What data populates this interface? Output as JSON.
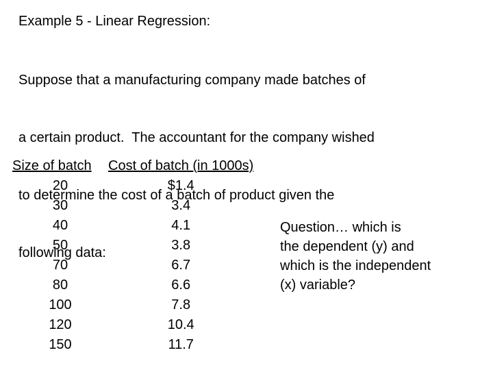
{
  "slide": {
    "title": "Example 5 - Linear Regression:",
    "intro_lines": [
      "Suppose that a manufacturing company made batches of",
      "a certain product.  The accountant for the company wished",
      "to determine the cost of a batch of product given the",
      "following data:"
    ],
    "question_lines": [
      "Question… which is",
      "the dependent (y) and",
      "which is the independent",
      "(x) variable?"
    ]
  },
  "chart_data": {
    "type": "table",
    "title": "Example 5 - Linear Regression:",
    "columns": [
      "Size of batch",
      "Cost of batch (in 1000s)"
    ],
    "xlabel": "Size of batch",
    "ylabel": "Cost of batch (in 1000s)",
    "rows": [
      {
        "size": "20",
        "cost": "$1.4"
      },
      {
        "size": "30",
        "cost": "3.4"
      },
      {
        "size": "40",
        "cost": "4.1"
      },
      {
        "size": "50",
        "cost": "3.8"
      },
      {
        "size": "70",
        "cost": "6.7"
      },
      {
        "size": "80",
        "cost": "6.6"
      },
      {
        "size": "100",
        "cost": "7.8"
      },
      {
        "size": "120",
        "cost": "10.4"
      },
      {
        "size": "150",
        "cost": "11.7"
      }
    ],
    "x": [
      20,
      30,
      40,
      50,
      70,
      80,
      100,
      120,
      150
    ],
    "values": [
      1.4,
      3.4,
      4.1,
      3.8,
      6.7,
      6.6,
      7.8,
      10.4,
      11.7
    ],
    "units": "thousands of dollars",
    "grid": false,
    "legend": "none"
  },
  "colors": {
    "background": "#ffffff",
    "text": "#000000"
  }
}
